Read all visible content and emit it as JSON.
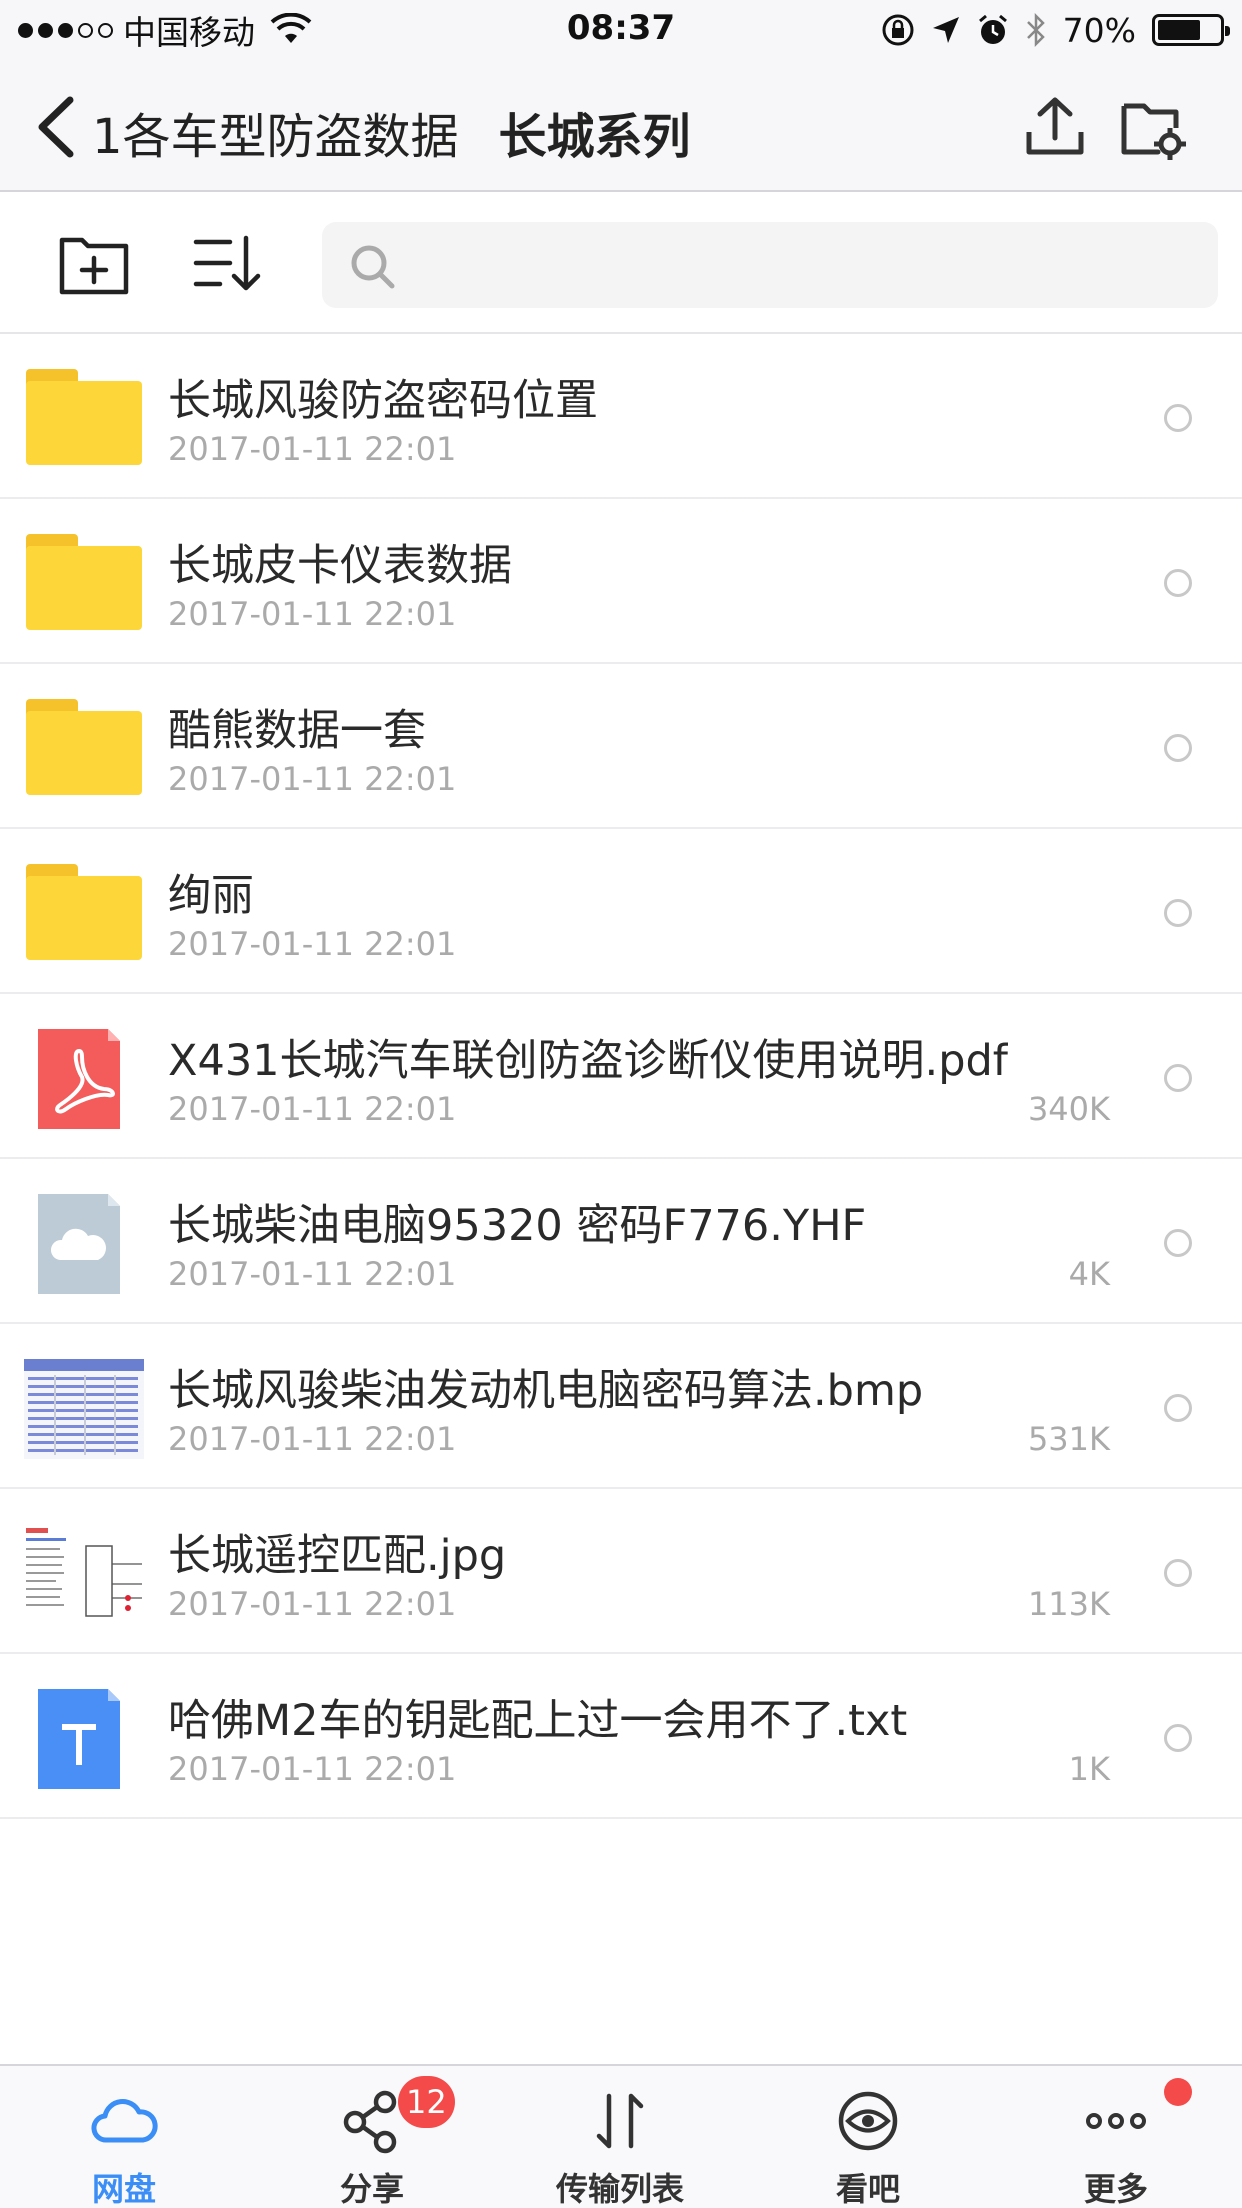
{
  "status_bar": {
    "carrier": "中国移动",
    "time": "08:37",
    "battery": "70%",
    "battery_level": 0.7
  },
  "header": {
    "back_label": "1各车型防盗数据",
    "title": "长城系列"
  },
  "search": {
    "placeholder": "",
    "value": ""
  },
  "files": [
    {
      "type": "folder",
      "name": "长城风骏防盗密码位置",
      "date": "2017-01-11 22:01",
      "size": ""
    },
    {
      "type": "folder",
      "name": "长城皮卡仪表数据",
      "date": "2017-01-11 22:01",
      "size": ""
    },
    {
      "type": "folder",
      "name": "酷熊数据一套",
      "date": "2017-01-11 22:01",
      "size": ""
    },
    {
      "type": "folder",
      "name": "绚丽",
      "date": "2017-01-11 22:01",
      "size": ""
    },
    {
      "type": "pdf",
      "name": "X431长城汽车联创防盗诊断仪使用说明.pdf",
      "date": "2017-01-11 22:01",
      "size": "340K"
    },
    {
      "type": "unknown",
      "name": "长城柴油电脑95320  密码F776.YHF",
      "date": "2017-01-11 22:01",
      "size": "4K"
    },
    {
      "type": "image-bmp",
      "name": "长城风骏柴油发动机电脑密码算法.bmp",
      "date": "2017-01-11 22:01",
      "size": "531K"
    },
    {
      "type": "image-jpg",
      "name": "长城遥控匹配.jpg",
      "date": "2017-01-11 22:01",
      "size": "113K"
    },
    {
      "type": "txt",
      "name": "哈佛M2车的钥匙配上过一会用不了.txt",
      "date": "2017-01-11 22:01",
      "size": "1K"
    }
  ],
  "tabs": [
    {
      "label": "网盘",
      "icon": "cloud-icon",
      "active": true
    },
    {
      "label": "分享",
      "icon": "share-icon",
      "badge": "12"
    },
    {
      "label": "传输列表",
      "icon": "transfer-icon"
    },
    {
      "label": "看吧",
      "icon": "eye-icon"
    },
    {
      "label": "更多",
      "icon": "more-icon",
      "dot": true
    }
  ],
  "colors": {
    "accent": "#3a8ef5",
    "folder": "#fdd63a",
    "pdf": "#f45b5b",
    "txt": "#4a8ff6",
    "badge": "#f44a4a"
  }
}
